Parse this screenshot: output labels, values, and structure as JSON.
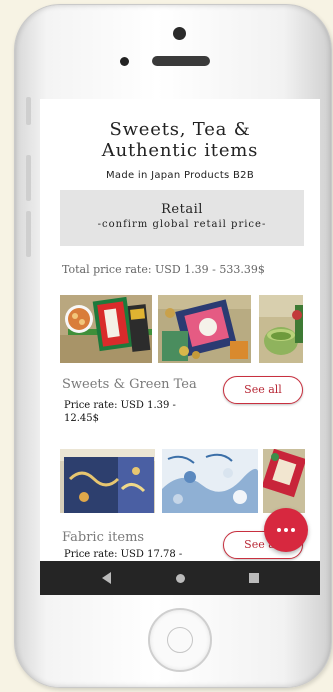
{
  "header": {
    "title_line1": "Sweets, Tea &",
    "title_line2": "Authentic items",
    "subtitle": "Made in Japan Products B2B"
  },
  "retail": {
    "title": "Retail",
    "subtitle": "-confirm global retail price-"
  },
  "total_price_rate": "Total price rate: USD 1.39 - 533.39$",
  "categories": [
    {
      "title": "Sweets & Green Tea",
      "price_line1": "Price rate: USD 1.39 -",
      "price_line2": "12.45$",
      "button_label": "See all"
    },
    {
      "title": "Fabric items",
      "price_line1": "Price rate: USD 17.78 -",
      "price_line2": "",
      "button_label": "See all"
    }
  ],
  "colors": {
    "accent": "#d7283f",
    "nav_bar": "#252525",
    "retail_bg": "#e4e4e4"
  },
  "icons": {
    "fab": "more-horizontal-icon",
    "nav_back": "back-triangle-icon",
    "nav_home": "home-circle-icon",
    "nav_recent": "recent-apps-square-icon"
  }
}
